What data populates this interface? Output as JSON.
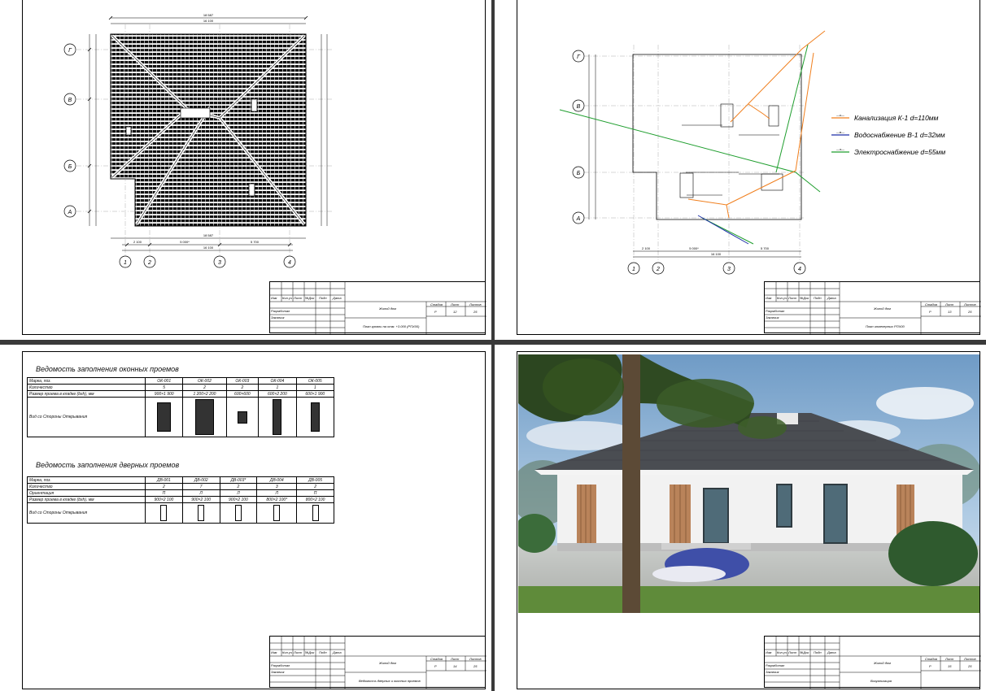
{
  "sheets": [
    {
      "id": "roof",
      "stamp": {
        "headers": [
          "Изм",
          "Кол.уч",
          "Лист",
          "№Док",
          "Подп",
          "Дата"
        ],
        "roles": [
          "Разработал",
          "Заказчик"
        ],
        "object": "Жилой дом",
        "sheet_title": "План кровли на отм. +3.000 (РПХ00)",
        "stage_label": "Стадия",
        "sheet_label": "Лист",
        "sheets_label": "Листов",
        "stage": "Р",
        "sheet_no": "12",
        "sheets_total": "25"
      },
      "axes": {
        "letters": [
          "Г",
          "В",
          "Б",
          "А"
        ],
        "numbers": [
          "1",
          "2",
          "3",
          "4"
        ]
      },
      "dims": {
        "top": [
          "18 587",
          "16 100"
        ],
        "bottom": [
          "2 100",
          "5 000*",
          "5 700",
          "18 587",
          "16 100"
        ]
      }
    },
    {
      "id": "utilities",
      "stamp": {
        "headers": [
          "Изм",
          "Кол.уч",
          "Лист",
          "№Док",
          "Подп",
          "Дата"
        ],
        "roles": [
          "Разработал",
          "Заказчик"
        ],
        "object": "Жилой дом",
        "sheet_title": "План инженерных РПХ00",
        "stage_label": "Стадия",
        "sheet_label": "Лист",
        "sheets_label": "Листов",
        "stage": "Р",
        "sheet_no": "13",
        "sheets_total": "25"
      },
      "axes": {
        "letters": [
          "Г",
          "В",
          "Б",
          "А"
        ],
        "numbers": [
          "1",
          "2",
          "3",
          "4"
        ]
      },
      "dims": {
        "bottom": [
          "2 100",
          "5 000*",
          "5 700",
          "16 100"
        ]
      },
      "legend": [
        {
          "mark": "—к—",
          "label": "Канализация К-1 d=110мм",
          "color": "#f07f1e"
        },
        {
          "mark": "—в—",
          "label": "Водоснабжение В-1 d=32мм",
          "color": "#1c2fa8"
        },
        {
          "mark": "—э—",
          "label": "Электроснабжение d=55мм",
          "color": "#1f9e2e"
        }
      ]
    },
    {
      "id": "schedules",
      "stamp": {
        "headers": [
          "Изм",
          "Кол.уч",
          "Лист",
          "№Док",
          "Подп",
          "Дата"
        ],
        "roles": [
          "Разработал",
          "Заказчик"
        ],
        "object": "Жилой дом",
        "sheet_title": "Ведомость дверных и оконных проемов",
        "stage_label": "Стадия",
        "sheet_label": "Лист",
        "sheets_label": "Листов",
        "stage": "Р",
        "sheet_no": "14",
        "sheets_total": "25"
      },
      "windows": {
        "title": "Ведомость заполнения оконных проемов",
        "row_labels": [
          "Марка, поз.",
          "Количество",
          "Размер проема в кладке (bxh), мм",
          "Вид со Стороны Открывания"
        ],
        "items": [
          {
            "mark": "ОК-001",
            "qty": "5",
            "size": "900×1 900"
          },
          {
            "mark": "ОК-002",
            "qty": "2",
            "size": "1 200×2 200"
          },
          {
            "mark": "ОК-003",
            "qty": "2",
            "size": "600×600"
          },
          {
            "mark": "ОК-004",
            "qty": "1",
            "size": "600×2 200"
          },
          {
            "mark": "ОК-005",
            "qty": "1",
            "size": "600×1 900"
          }
        ]
      },
      "doors": {
        "title": "Ведомость заполнения дверных проемов",
        "row_labels": [
          "Марка, поз.",
          "Количество",
          "Ориентация",
          "Размер проема в кладке (bxh), мм",
          "Вид со Стороны Открывания"
        ],
        "items": [
          {
            "mark": "ДВ-001",
            "qty": "2",
            "orient": "П",
            "size": "900×2 100"
          },
          {
            "mark": "ДВ-002",
            "qty": "7",
            "orient": "Л",
            "size": "900×2 100"
          },
          {
            "mark": "ДВ-003*",
            "qty": "2",
            "orient": "Л",
            "size": "900×2 100"
          },
          {
            "mark": "ДВ-004",
            "qty": "3",
            "orient": "Л",
            "size": "800×2 100*"
          },
          {
            "mark": "ДВ-005",
            "qty": "2",
            "orient": "П",
            "size": "800×2 100"
          }
        ]
      }
    },
    {
      "id": "render",
      "stamp": {
        "headers": [
          "Изм",
          "Кол.уч",
          "Лист",
          "№Док",
          "Подп",
          "Дата"
        ],
        "roles": [
          "Разработал",
          "Заказчик"
        ],
        "object": "Жилой дом",
        "sheet_title": "Визуализация",
        "stage_label": "Стадия",
        "sheet_label": "Лист",
        "sheets_label": "Листов",
        "stage": "Р",
        "sheet_no": "15",
        "sheets_total": "25"
      }
    }
  ]
}
